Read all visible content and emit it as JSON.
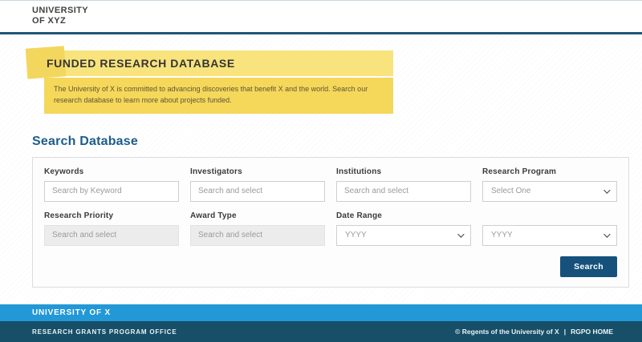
{
  "header": {
    "brand_line1": "UNIVERSITY",
    "brand_line2": "OF XYZ"
  },
  "hero": {
    "title": "FUNDED RESEARCH DATABASE",
    "description": "The University of X is committed to advancing discoveries that benefit X and the world. Search our research database to learn more about projects funded."
  },
  "search": {
    "heading": "Search Database",
    "button_label": "Search"
  },
  "form": {
    "row1": [
      {
        "label": "Keywords",
        "placeholder": "Search by Keyword",
        "type": "text",
        "state": "enabled"
      },
      {
        "label": "Investigators",
        "placeholder": "Search and select",
        "type": "text",
        "state": "enabled"
      },
      {
        "label": "Institutions",
        "placeholder": "Search and select",
        "type": "text",
        "state": "enabled"
      },
      {
        "label": "Research Program",
        "value": "Select One",
        "type": "select",
        "state": "enabled"
      }
    ],
    "row2": [
      {
        "label": "Research Priority",
        "placeholder": "Search and select",
        "type": "text",
        "state": "disabled"
      },
      {
        "label": "Award Type",
        "placeholder": "Search and select",
        "type": "text",
        "state": "disabled"
      },
      {
        "label": "Date Range",
        "value": "YYYY",
        "type": "select",
        "state": "enabled"
      },
      {
        "label": "",
        "value": "YYYY",
        "type": "select",
        "state": "enabled"
      }
    ]
  },
  "footer": {
    "university": "UNIVERSITY OF X",
    "office": "RESEARCH GRANTS PROGRAM OFFICE",
    "copyright": "© Regents of the University of X",
    "divider": "|",
    "home_link": "RGPO HOME"
  },
  "colors": {
    "header_rule": "#1e5679",
    "hero_title_bg": "#f8e37d",
    "hero_accent_bg": "#f3d65e",
    "hero_desc_bg": "#f5d75a",
    "heading_blue": "#1d5c8c",
    "button_bg": "#15517b",
    "footer_blue": "#2298d6",
    "footer_dark": "#174f68"
  }
}
